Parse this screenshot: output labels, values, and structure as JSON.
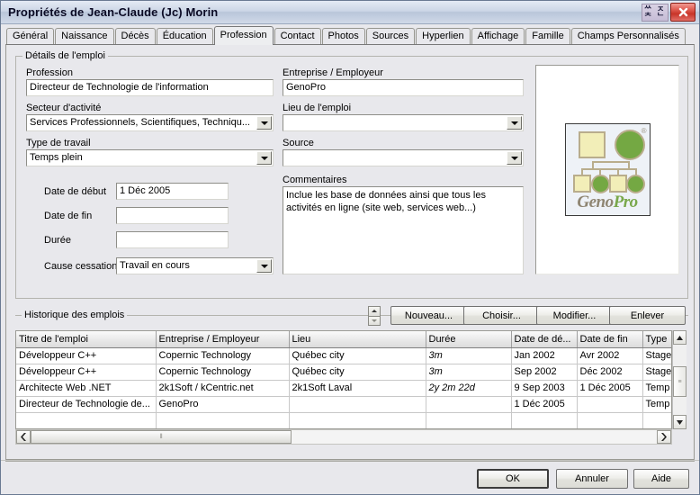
{
  "window": {
    "title": "Propriétés de Jean-Claude (Jc) Morin",
    "close_icon": "close-icon",
    "ime": {
      "g1": "ᄊ",
      "g2": "ᄎ",
      "g3": "ㅈ",
      "g4": "ᄂ"
    }
  },
  "tabs": [
    {
      "label": "Général",
      "active": false
    },
    {
      "label": "Naissance",
      "active": false
    },
    {
      "label": "Décès",
      "active": false
    },
    {
      "label": "Éducation",
      "active": false
    },
    {
      "label": "Profession",
      "active": true
    },
    {
      "label": "Contact",
      "active": false
    },
    {
      "label": "Photos",
      "active": false
    },
    {
      "label": "Sources",
      "active": false
    },
    {
      "label": "Hyperlien",
      "active": false
    },
    {
      "label": "Affichage",
      "active": false
    },
    {
      "label": "Famille",
      "active": false
    },
    {
      "label": "Champs Personnalisés",
      "active": false
    }
  ],
  "details": {
    "group_title": "Détails de l'emploi",
    "profession_label": "Profession",
    "profession_value": "Directeur de Technologie de l'information",
    "secteur_label": "Secteur d'activité",
    "secteur_value": "Services Professionnels, Scientifiques, Techniqu...",
    "type_travail_label": "Type de travail",
    "type_travail_value": "Temps plein",
    "entreprise_label": "Entreprise / Employeur",
    "entreprise_value": "GenoPro",
    "lieu_label": "Lieu de l'emploi",
    "lieu_value": "",
    "source_label": "Source",
    "source_value": "",
    "date_debut_label": "Date de début",
    "date_debut_value": "1 Déc 2005",
    "date_fin_label": "Date de fin",
    "date_fin_value": "",
    "duree_label": "Durée",
    "duree_value": "",
    "cause_label": "Cause cessation",
    "cause_value": "Travail en cours",
    "commentaires_label": "Commentaires",
    "commentaires_value": "Inclue les base de données ainsi que tous les activités en ligne (site web, services web...)"
  },
  "logo": {
    "name_part1": "Geno",
    "name_part2": "Pro",
    "registered": "®",
    "square_color": "#f2eeb8",
    "circle_color": "#74a843",
    "outline_color": "#b9ad8c"
  },
  "history": {
    "group_title": "Historique des emplois",
    "buttons": {
      "nouveau": "Nouveau...",
      "choisir": "Choisir...",
      "modifier": "Modifier...",
      "enlever": "Enlever"
    },
    "columns": [
      "Titre de l'emploi",
      "Entreprise / Employeur",
      "Lieu",
      "Durée",
      "Date de dé...",
      "Date de fin",
      "Type"
    ],
    "rows": [
      {
        "titre": "Développeur C++",
        "entreprise": "Copernic Technology",
        "lieu": "Québec city",
        "duree": "3m",
        "date_debut": "Jan 2002",
        "date_fin": "Avr 2002",
        "type": "Stage"
      },
      {
        "titre": "Développeur C++",
        "entreprise": "Copernic Technology",
        "lieu": "Québec city",
        "duree": "3m",
        "date_debut": "Sep 2002",
        "date_fin": "Déc 2002",
        "type": "Stage"
      },
      {
        "titre": "Architecte Web .NET",
        "entreprise": "2k1Soft / kCentric.net",
        "lieu": "2k1Soft Laval",
        "duree": "2y 2m 22d",
        "date_debut": "9 Sep 2003",
        "date_fin": "1 Déc 2005",
        "type": "Temp"
      },
      {
        "titre": "Directeur de Technologie de...",
        "entreprise": "GenoPro",
        "lieu": "",
        "duree": "",
        "date_debut": "1 Déc 2005",
        "date_fin": "",
        "type": "Temp"
      },
      {
        "titre": "",
        "entreprise": "",
        "lieu": "",
        "duree": "",
        "date_debut": "",
        "date_fin": "",
        "type": ""
      }
    ]
  },
  "footer": {
    "ok": "OK",
    "annuler": "Annuler",
    "aide": "Aide"
  }
}
